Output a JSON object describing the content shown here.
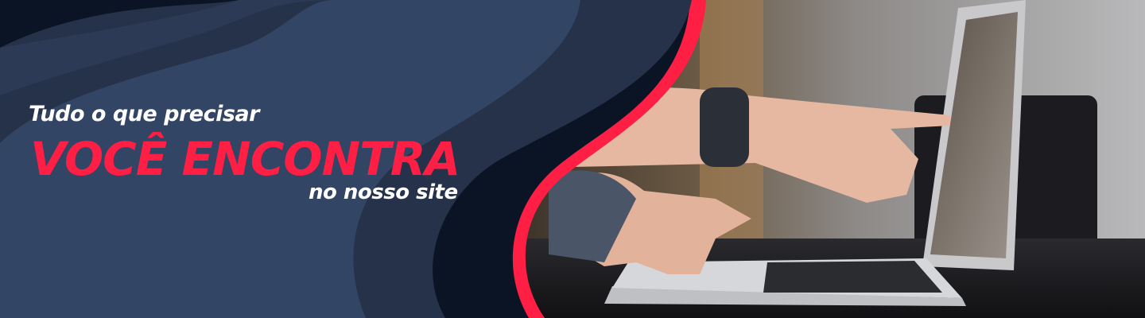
{
  "banner": {
    "line1": "Tudo o que precisar",
    "line2": "VOCÊ ENCONTRA",
    "line3": "no nosso site"
  },
  "colors": {
    "accent": "#ff1f44",
    "dark": "#0b1424",
    "mid": "#26324a",
    "light": "#334565"
  }
}
